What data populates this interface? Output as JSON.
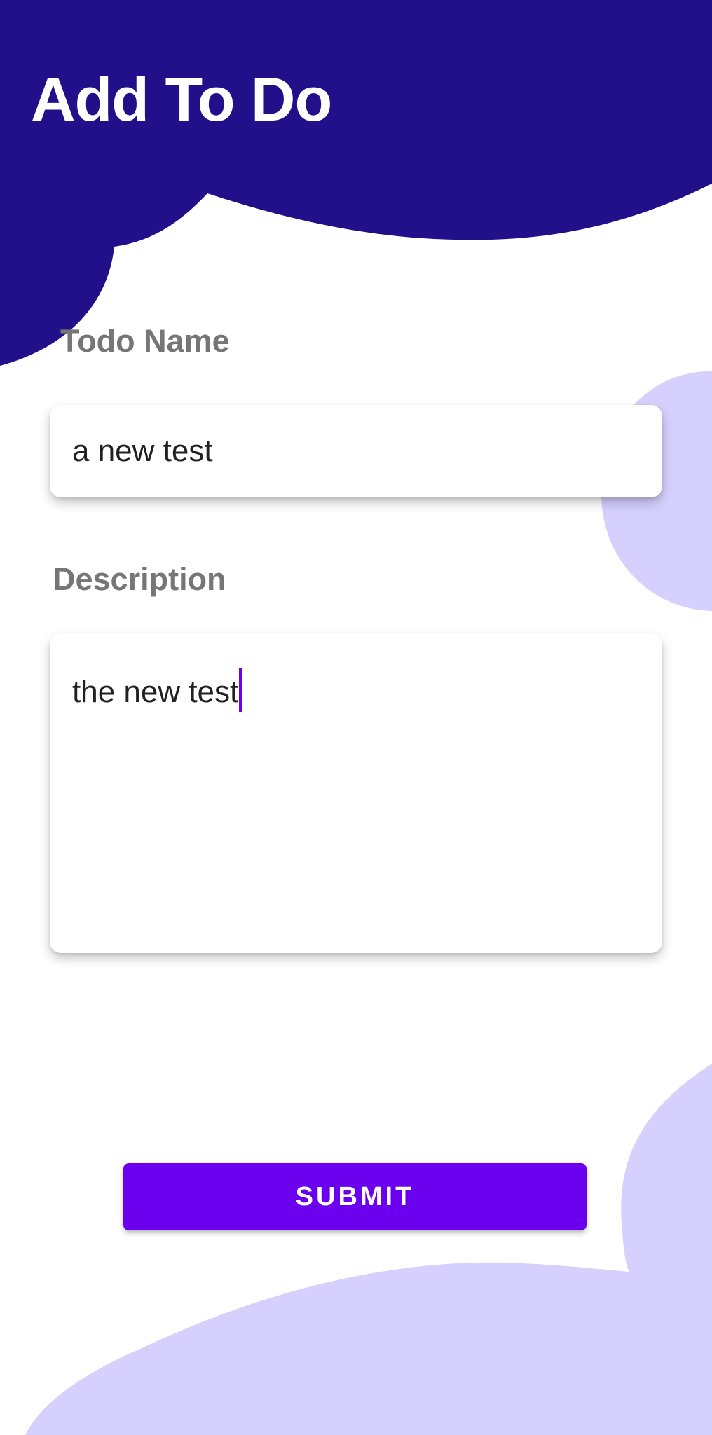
{
  "header": {
    "title": "Add To Do"
  },
  "form": {
    "name_label": "Todo Name",
    "name_value": "a new test",
    "description_label": "Description",
    "description_value": "the new test"
  },
  "actions": {
    "submit_label": "SUBMIT"
  },
  "colors": {
    "header_background": "#22108a",
    "decor_blob": "#d6d0fe",
    "primary": "#6a00ee",
    "label_text": "#767676",
    "input_text": "#212121"
  }
}
